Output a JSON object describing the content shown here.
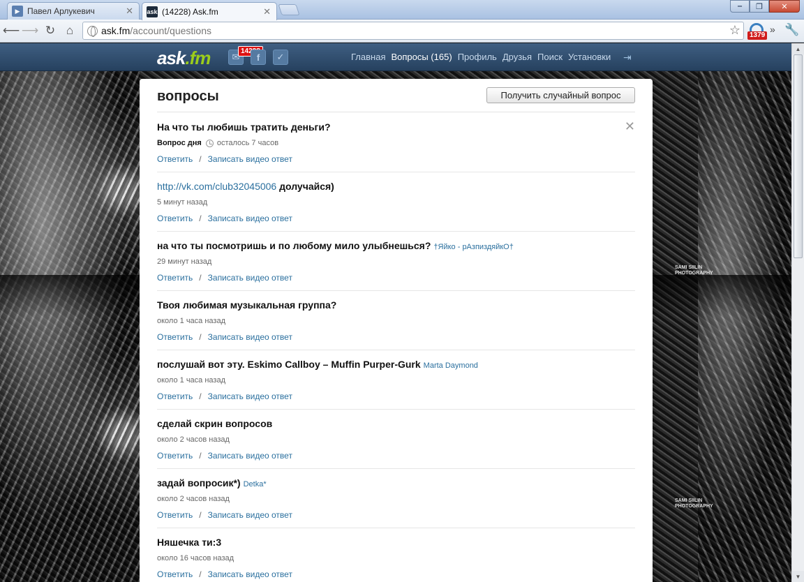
{
  "browser": {
    "tabs": [
      {
        "label": "Павел Арлукевич",
        "favicon": "play-icon",
        "active": false
      },
      {
        "label": "(14228) Ask.fm",
        "favicon": "ask-icon",
        "active": true
      }
    ],
    "favicon_text": "ask",
    "url_host": "ask.fm",
    "url_path": "/account/questions",
    "extension_badge": "1379"
  },
  "site": {
    "logo_main": "ask",
    "logo_suffix": ".fm",
    "notifications_count": "14228",
    "nav": [
      {
        "label": "Главная",
        "current": false
      },
      {
        "label": "Вопросы (165)",
        "current": true
      },
      {
        "label": "Профиль",
        "current": false
      },
      {
        "label": "Друзья",
        "current": false
      },
      {
        "label": "Поиск",
        "current": false
      },
      {
        "label": "Установки",
        "current": false
      }
    ],
    "watermark_line1": "SAMI SIILIN",
    "watermark_line2": "PHOTOGRAPHY"
  },
  "panel": {
    "title": "вопросы",
    "random_button": "Получить случайный вопрос"
  },
  "actions": {
    "answer": "Ответить",
    "separator": "/",
    "video": "Записать видео ответ"
  },
  "questions": [
    {
      "text": "На что ты любишь тратить деньги?",
      "qotd_label": "Вопрос дня",
      "time": "осталось 7 часов"
    },
    {
      "link": "http://vk.com/club32045006",
      "text": " долучайся)",
      "time": "5 минут назад"
    },
    {
      "text": "на что ты посмотришь и по любому мило улыбнешься?",
      "author": "†Яйко - рАзпиздяйкО†",
      "time": "29 минут назад"
    },
    {
      "text": "Твоя любимая музыкальная группа?",
      "time": "около 1 часа назад"
    },
    {
      "text": "послушай вот эту. Eskimo Callboy – Muffin Purper-Gurk",
      "author": "Marta Daymond",
      "time": "около 1 часа назад"
    },
    {
      "text": "сделай скрин вопросов",
      "time": "около 2 часов назад"
    },
    {
      "text": "задай вопросик*)",
      "author": "Detka*",
      "time": "около 2 часов назад"
    },
    {
      "text": "Няшечка ти:3",
      "time": "около 16 часов назад"
    }
  ]
}
